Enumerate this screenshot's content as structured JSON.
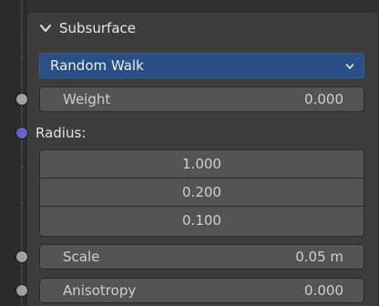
{
  "panel": {
    "title": "Subsurface",
    "method": "Random Walk",
    "weight": {
      "label": "Weight",
      "value": "0.000"
    },
    "radius": {
      "label": "Radius:",
      "values": [
        "1.000",
        "0.200",
        "0.100"
      ]
    },
    "scale": {
      "label": "Scale",
      "value": "0.05 m"
    },
    "anisotropy": {
      "label": "Anisotropy",
      "value": "0.000"
    }
  },
  "colors": {
    "background": "#303030",
    "panel": "#3d3d3d",
    "field": "#545454",
    "dropdown": "#284f86",
    "socket_grey": "#a1a1a1",
    "socket_vector": "#6363c7"
  },
  "icons": {
    "collapse": "chevron-down-icon",
    "dropdown": "chevron-down-icon"
  }
}
